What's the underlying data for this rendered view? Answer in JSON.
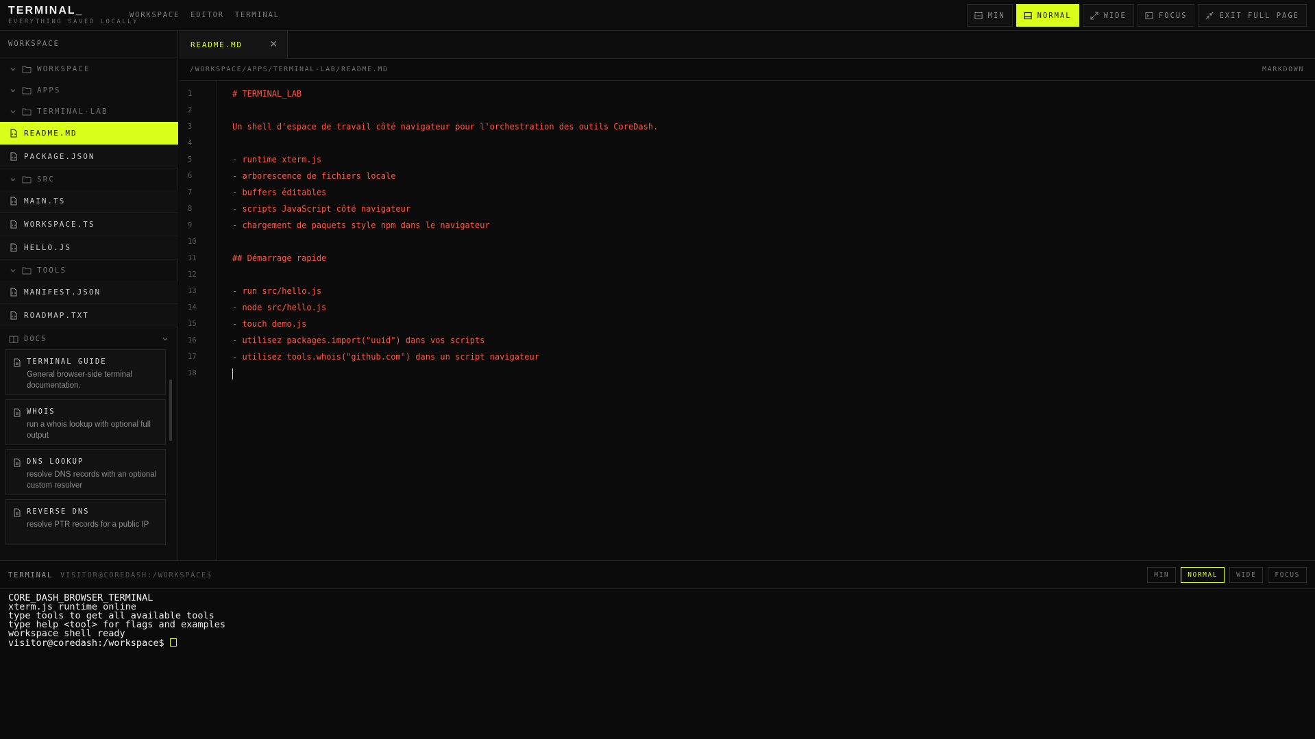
{
  "app": {
    "title": "TERMINAL_",
    "subtitle": "EVERYTHING SAVED LOCALLY",
    "nav": [
      "WORKSPACE",
      "EDITOR",
      "TERMINAL"
    ],
    "view_buttons": [
      {
        "label": "MIN",
        "icon": "minimize-icon",
        "active": false
      },
      {
        "label": "NORMAL",
        "icon": "layout-icon",
        "active": true
      },
      {
        "label": "WIDE",
        "icon": "expand-icon",
        "active": false
      },
      {
        "label": "FOCUS",
        "icon": "terminal-icon",
        "active": false
      },
      {
        "label": "EXIT FULL PAGE",
        "icon": "shrink-icon",
        "active": false
      }
    ]
  },
  "sidebar": {
    "header": "WORKSPACE",
    "tree": [
      {
        "type": "folder",
        "label": "WORKSPACE"
      },
      {
        "type": "folder",
        "label": "APPS"
      },
      {
        "type": "folder",
        "label": "TERMINAL-LAB"
      },
      {
        "type": "file",
        "label": "README.MD",
        "selected": true
      },
      {
        "type": "file",
        "label": "PACKAGE.JSON"
      },
      {
        "type": "folder",
        "label": "SRC"
      },
      {
        "type": "file",
        "label": "MAIN.TS"
      },
      {
        "type": "file",
        "label": "WORKSPACE.TS"
      },
      {
        "type": "file",
        "label": "HELLO.JS"
      },
      {
        "type": "folder",
        "label": "TOOLS"
      },
      {
        "type": "file",
        "label": "MANIFEST.JSON"
      },
      {
        "type": "file",
        "label": "ROADMAP.TXT"
      }
    ],
    "docs": {
      "header": "DOCS",
      "items": [
        {
          "title": "TERMINAL GUIDE",
          "desc": "General browser-side terminal documentation."
        },
        {
          "title": "WHOIS",
          "desc": "run a whois lookup with optional full output"
        },
        {
          "title": "DNS LOOKUP",
          "desc": "resolve DNS records with an optional custom resolver"
        },
        {
          "title": "REVERSE DNS",
          "desc": "resolve PTR records for a public IP"
        }
      ]
    }
  },
  "editor": {
    "tab": "README.MD",
    "path": "/WORKSPACE/APPS/TERMINAL-LAB/README.MD",
    "mode": "MARKDOWN",
    "lines": [
      "# TERMINAL_LAB",
      "",
      "Un shell d'espace de travail côté navigateur pour l'orchestration des outils CoreDash.",
      "",
      "- runtime xterm.js",
      "- arborescence de fichiers locale",
      "- buffers éditables",
      "- scripts JavaScript côté navigateur",
      "- chargement de paquets style npm dans le navigateur",
      "",
      "## Démarrage rapide",
      "",
      "- run src/hello.js",
      "- node src/hello.js",
      "- touch demo.js",
      "- utilisez packages.import(\"uuid\") dans vos scripts",
      "- utilisez tools.whois(\"github.com\") dans un script navigateur",
      ""
    ]
  },
  "terminal": {
    "label": "TERMINAL",
    "prompt_path": "VISITOR@COREDASH:/WORKSPACE$",
    "buttons": [
      {
        "label": "MIN",
        "active": false
      },
      {
        "label": "NORMAL",
        "active": true
      },
      {
        "label": "WIDE",
        "active": false
      },
      {
        "label": "FOCUS",
        "active": false
      }
    ],
    "output": [
      "CORE_DASH_BROWSER_TERMINAL",
      "xterm.js runtime online",
      "type tools to get all available tools",
      "type help <tool> for flags and examples",
      "workspace shell ready"
    ],
    "prompt": "visitor@coredash:/workspace$ "
  },
  "colors": {
    "accent": "#d9ff1a",
    "code": "#ff5a44",
    "background": "#0b0b0b"
  }
}
